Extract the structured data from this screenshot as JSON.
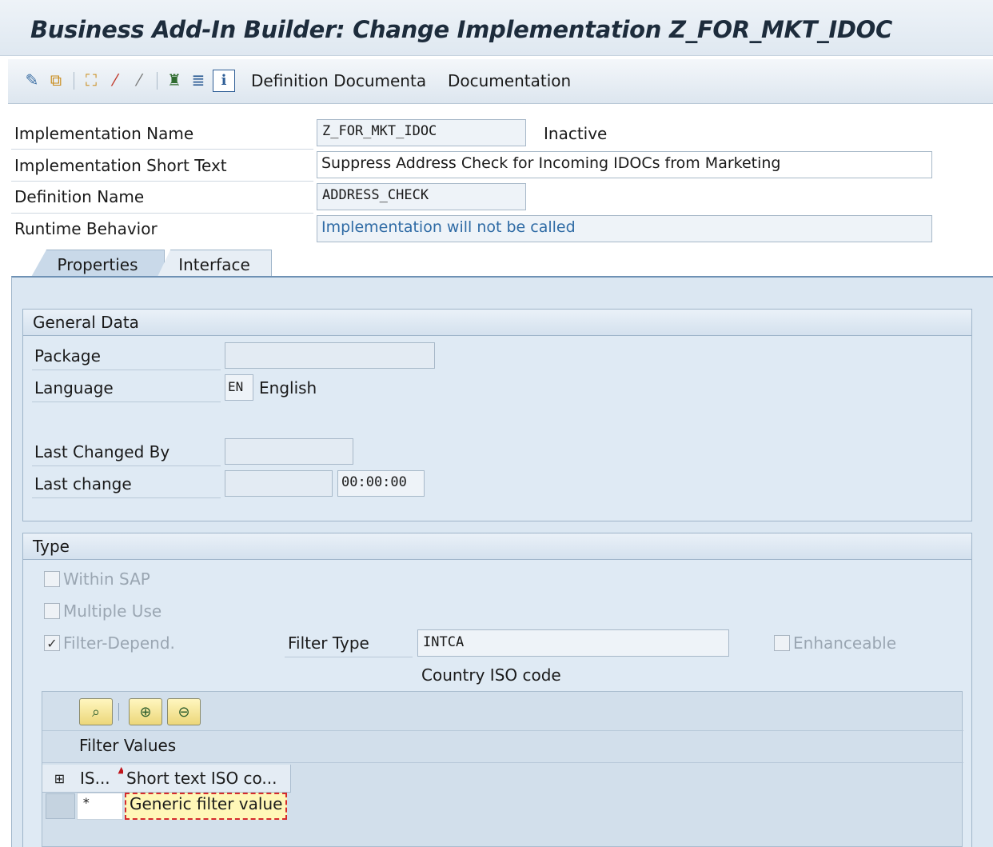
{
  "window": {
    "title": "Business Add-In Builder: Change Implementation Z_FOR_MKT_IDOC"
  },
  "toolbar": {
    "icons": [
      "display-change-icon",
      "copy-icon",
      "hierarchy-icon",
      "magic-wand-icon",
      "wand-icon",
      "structure-icon",
      "list-icon",
      "info-icon"
    ],
    "definition_documentation": "Definition Documenta",
    "documentation": "Documentation"
  },
  "header": {
    "impl_name_label": "Implementation Name",
    "impl_name_value": "Z_FOR_MKT_IDOC",
    "impl_status": "Inactive",
    "short_text_label": "Implementation Short Text",
    "short_text_value": "Suppress Address Check for Incoming IDOCs from Marketing",
    "definition_name_label": "Definition Name",
    "definition_name_value": "ADDRESS_CHECK",
    "runtime_label": "Runtime Behavior",
    "runtime_value": "Implementation will not be called"
  },
  "tabs": [
    {
      "label": "Properties",
      "active": true
    },
    {
      "label": "Interface",
      "active": false
    }
  ],
  "general_data": {
    "title": "General Data",
    "package_label": "Package",
    "package_value": "",
    "language_label": "Language",
    "language_code": "EN",
    "language_name": "English",
    "last_changed_by_label": "Last Changed By",
    "last_changed_by_value": "",
    "last_change_label": "Last change",
    "last_change_date": "",
    "last_change_time": "00:00:00"
  },
  "type_group": {
    "title": "Type",
    "within_sap": {
      "label": "Within SAP",
      "checked": false
    },
    "multiple_use": {
      "label": "Multiple Use",
      "checked": false
    },
    "filter_depend": {
      "label": "Filter-Depend.",
      "checked": true
    },
    "filter_type_label": "Filter Type",
    "filter_type_value": "INTCA",
    "filter_type_desc": "Country ISO code",
    "enhanceable": {
      "label": "Enhanceable",
      "checked": false
    }
  },
  "filter_table": {
    "title": "Filter Values",
    "columns": [
      "IS...",
      "Short text ISO co..."
    ],
    "rows": [
      {
        "iso": "*",
        "text": "Generic filter value"
      }
    ]
  }
}
